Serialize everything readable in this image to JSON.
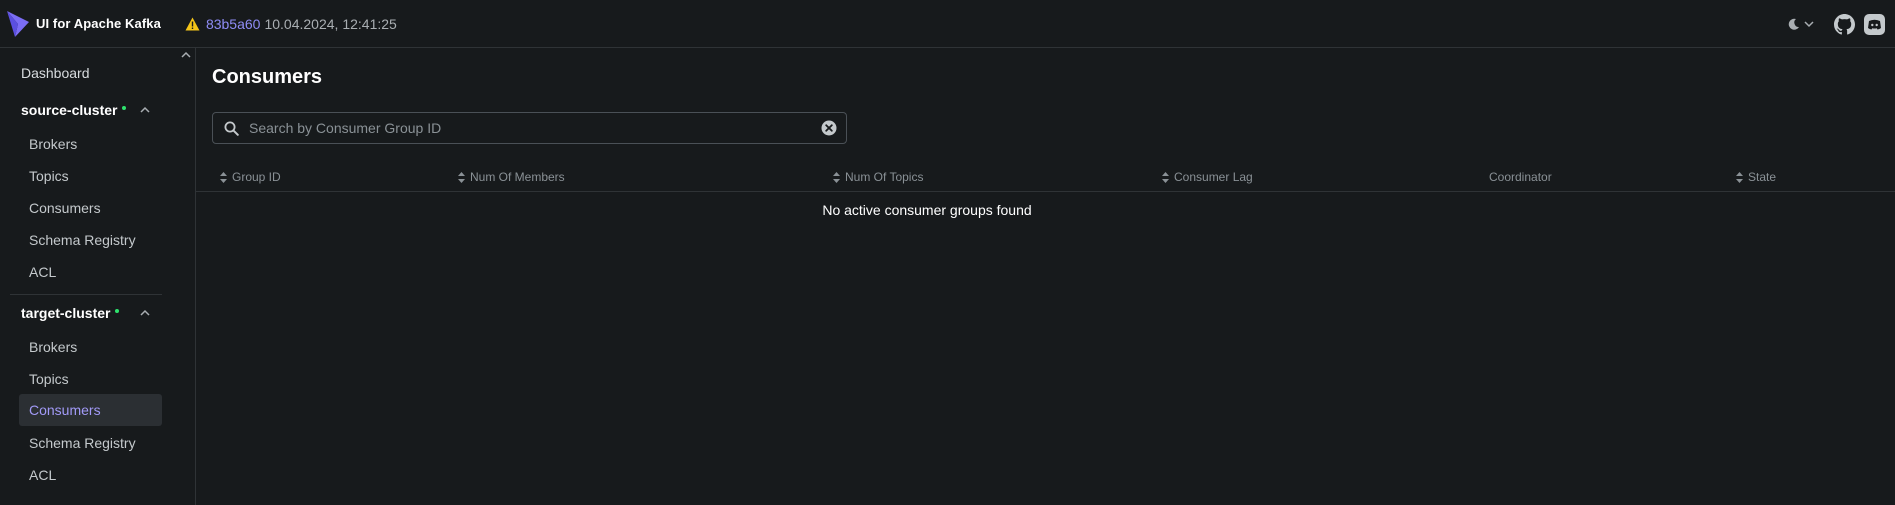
{
  "header": {
    "app_title": "UI for Apache Kafka",
    "commit": "83b5a60",
    "build_date": "10.04.2024, 12:41:25",
    "icons": [
      "kafka-logo",
      "warning-icon",
      "moon-icon",
      "chevron-down-icon",
      "github-icon",
      "discord-icon"
    ]
  },
  "sidebar": {
    "dashboard_label": "Dashboard",
    "clusters": [
      {
        "name": "source-cluster",
        "status": "online",
        "expanded": true,
        "items": [
          {
            "label": "Brokers"
          },
          {
            "label": "Topics"
          },
          {
            "label": "Consumers"
          },
          {
            "label": "Schema Registry"
          },
          {
            "label": "ACL"
          }
        ]
      },
      {
        "name": "target-cluster",
        "status": "online",
        "expanded": true,
        "items": [
          {
            "label": "Brokers"
          },
          {
            "label": "Topics"
          },
          {
            "label": "Consumers",
            "active": true
          },
          {
            "label": "Schema Registry"
          },
          {
            "label": "ACL"
          }
        ]
      }
    ]
  },
  "main": {
    "title": "Consumers",
    "search": {
      "placeholder": "Search by Consumer Group ID",
      "value": ""
    },
    "table": {
      "columns": [
        {
          "label": "Group ID",
          "sortable": true
        },
        {
          "label": "Num Of Members",
          "sortable": true
        },
        {
          "label": "Num Of Topics",
          "sortable": true
        },
        {
          "label": "Consumer Lag",
          "sortable": true
        },
        {
          "label": "Coordinator",
          "sortable": false
        },
        {
          "label": "State",
          "sortable": true
        }
      ],
      "rows": [],
      "empty_message": "No active consumer groups found"
    }
  },
  "colors": {
    "background": "#171a1c",
    "accent": "#8f8cf5",
    "active_nav_text": "#a29af7",
    "status_online": "#2ee26d",
    "warning": "#f5c518"
  }
}
